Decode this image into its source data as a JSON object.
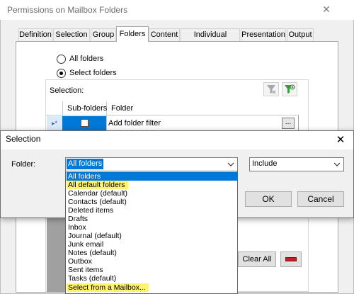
{
  "window": {
    "title": "Permissions on Mailbox Folders"
  },
  "tabs": [
    {
      "label": "Definition"
    },
    {
      "label": "Selection"
    },
    {
      "label": "Group"
    },
    {
      "label": "Folders",
      "active": true
    },
    {
      "label": "Content"
    },
    {
      "label": "Individual reports"
    },
    {
      "label": "Presentation"
    },
    {
      "label": "Output"
    }
  ],
  "folders_panel": {
    "radio_all": "All folders",
    "radio_select": "Select folders",
    "selected_radio": "Select folders",
    "selection_label": "Selection:",
    "grid": {
      "columns": [
        "Sub-folders",
        "Folder"
      ],
      "row": {
        "folder": "Add folder filter",
        "subfolders_checked": false,
        "browse": "..."
      }
    },
    "clear_all": "Clear All"
  },
  "dialog": {
    "title": "Selection",
    "folder_label": "Folder:",
    "folder_value": "All folders",
    "include_value": "Include",
    "ok": "OK",
    "cancel": "Cancel",
    "dropdown": {
      "items": [
        {
          "label": "All folders",
          "selected": true
        },
        {
          "label": "All default folders",
          "highlighted": true
        },
        {
          "label": "Calendar  (default)"
        },
        {
          "label": "Contacts  (default)"
        },
        {
          "label": "Deleted items"
        },
        {
          "label": "Drafts"
        },
        {
          "label": "Inbox"
        },
        {
          "label": "Journal  (default)"
        },
        {
          "label": "Junk email"
        },
        {
          "label": "Notes  (default)"
        },
        {
          "label": "Outbox"
        },
        {
          "label": "Sent items"
        },
        {
          "label": "Tasks  (default)"
        },
        {
          "label": "Select from a Mailbox...",
          "highlighted": true
        }
      ]
    }
  },
  "colors": {
    "accent": "#0078d7",
    "highlight": "#fff36b",
    "remove_red": "#c0202a"
  }
}
